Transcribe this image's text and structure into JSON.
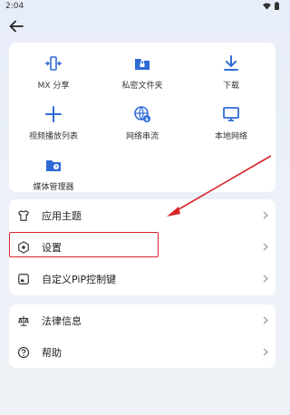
{
  "status_bar": {
    "time": "2:04"
  },
  "grid": {
    "items": [
      {
        "label": "MX 分享",
        "icon": "share-icon"
      },
      {
        "label": "私密文件夹",
        "icon": "private-folder-icon"
      },
      {
        "label": "下载",
        "icon": "download-icon"
      },
      {
        "label": "视频播放列表",
        "icon": "add-playlist-icon"
      },
      {
        "label": "网络串流",
        "icon": "network-stream-icon"
      },
      {
        "label": "本地网络",
        "icon": "local-network-icon"
      },
      {
        "label": "媒体管理器",
        "icon": "media-manager-icon"
      }
    ]
  },
  "menu": {
    "group1": [
      {
        "label": "应用主题",
        "icon": "shirt-icon"
      },
      {
        "label": "设置",
        "icon": "gear-icon"
      },
      {
        "label": "自定义PiP控制键",
        "icon": "pip-icon"
      }
    ],
    "group2": [
      {
        "label": "法律信息",
        "icon": "scales-icon"
      },
      {
        "label": "帮助",
        "icon": "help-icon"
      }
    ]
  },
  "colors": {
    "accent": "#2e6bd6",
    "highlight": "#d9252a",
    "background": "#e8eef9"
  }
}
